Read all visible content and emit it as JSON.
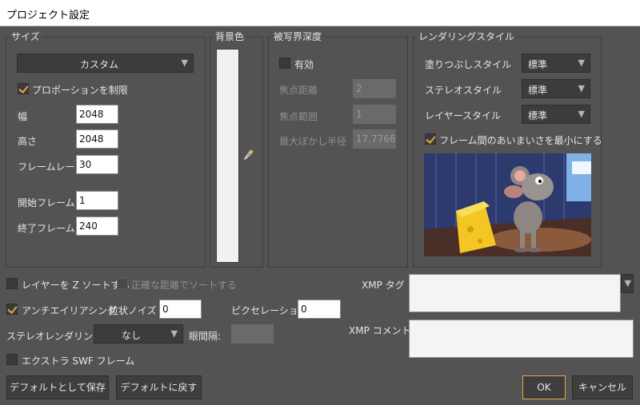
{
  "window": {
    "title": "プロジェクト設定"
  },
  "size": {
    "group_label": "サイズ",
    "preset": "カスタム",
    "constrain_label": "プロポーションを制限",
    "constrain_checked": true,
    "width_label": "幅",
    "width_value": "2048",
    "height_label": "高さ",
    "height_value": "2048",
    "framerate_label": "フレームレート",
    "framerate_value": "30",
    "start_label": "開始フレーム",
    "start_value": "1",
    "end_label": "終了フレーム",
    "end_value": "240"
  },
  "background": {
    "group_label": "背景色",
    "color": "#f1f1f1"
  },
  "dof": {
    "group_label": "被写界深度",
    "enable_label": "有効",
    "enable_checked": false,
    "focus_distance_label": "焦点距離",
    "focus_distance_value": "2",
    "focus_range_label": "焦点範囲",
    "focus_range_value": "1",
    "max_blur_label": "最大ぼかし半径",
    "max_blur_value": "17.7766"
  },
  "render_style": {
    "group_label": "レンダリングスタイル",
    "fill_label": "塗りつぶしスタイル",
    "fill_value": "標準",
    "stroke_label": "ステレオスタイル",
    "stroke_value": "標準",
    "layer_label": "レイヤースタイル",
    "layer_value": "標準",
    "minimize_label": "フレーム間のあいまいさを最小にする",
    "minimize_checked": true
  },
  "options": {
    "zsort_label": "レイヤーを Z ソートする",
    "exact_label": "正確な距離でソートする",
    "antialias_label": "アンチエイリアシング",
    "noise_label": "粒状ノイズ",
    "noise_value": "0",
    "pixelation_label": "ピクセレーション",
    "pixelation_value": "0",
    "stereo_label": "ステレオレンダリング:",
    "stereo_value": "なし",
    "eye_label": "眼間隔:",
    "swf_label": "エクストラ SWF フレーム",
    "xmp_tag_label": "XMP タグ",
    "xmp_comment_label": "XMP コメント"
  },
  "buttons": {
    "save_default": "デフォルトとして保存",
    "revert_default": "デフォルトに戻す",
    "ok": "OK",
    "cancel": "キャンセル"
  }
}
